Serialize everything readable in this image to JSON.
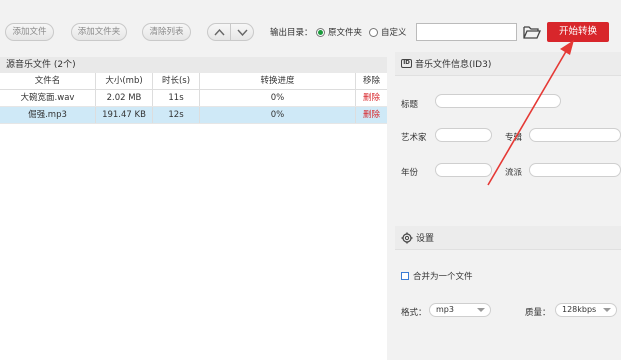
{
  "toolbar": {
    "add_file": "添加文件",
    "add_folder": "添加文件夹",
    "clear_list": "清除列表",
    "output_label": "输出目录：",
    "radio_original": "原文件夹",
    "radio_custom": "自定义",
    "path_value": "",
    "start_button": "开始转换"
  },
  "file_list": {
    "title": "源音乐文件 (2个)",
    "columns": [
      "文件名",
      "大小(mb)",
      "时长(s)",
      "转换进度",
      "移除"
    ],
    "rows": [
      {
        "name": "大碗宽面.wav",
        "size": "2.02 MB",
        "duration": "11s",
        "progress": "0%",
        "remove": "删除",
        "selected": false
      },
      {
        "name": "倔强.mp3",
        "size": "191.47 KB",
        "duration": "12s",
        "progress": "0%",
        "remove": "删除",
        "selected": true
      }
    ]
  },
  "id3": {
    "title": "音乐文件信息(ID3)",
    "icon_text": "ID",
    "labels": {
      "title": "标题",
      "artist": "艺术家",
      "album": "专辑",
      "year": "年份",
      "genre": "流派"
    }
  },
  "settings": {
    "title": "设置",
    "merge_label": "合并为一个文件",
    "format_label": "格式：",
    "format_value": "mp3",
    "quality_label": "质量：",
    "quality_value": "128kbps"
  },
  "colors": {
    "accent": "#d8262b",
    "selected_row": "#cfe9f7",
    "radio_on": "#1a9a3c"
  }
}
